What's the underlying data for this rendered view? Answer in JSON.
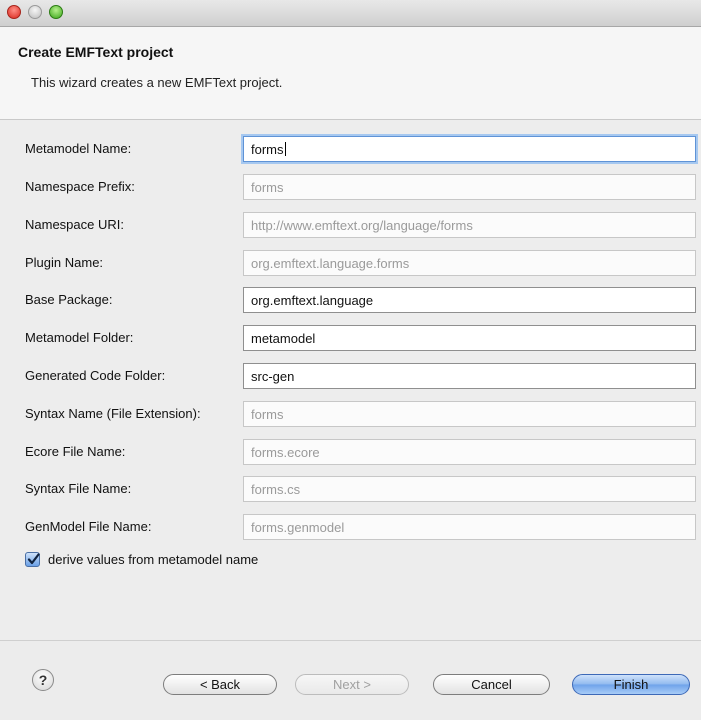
{
  "window": {
    "controls": {
      "close": "close",
      "minimize": "minimize",
      "zoom": "zoom"
    }
  },
  "header": {
    "title": "Create EMFText project",
    "description": "This wizard creates a new EMFText project."
  },
  "form": {
    "fields": [
      {
        "label": "Metamodel Name:",
        "value": "forms",
        "state": "enabled",
        "focused": true
      },
      {
        "label": "Namespace Prefix:",
        "value": "forms",
        "state": "disabled"
      },
      {
        "label": "Namespace URI:",
        "value": "http://www.emftext.org/language/forms",
        "state": "disabled"
      },
      {
        "label": "Plugin Name:",
        "value": "org.emftext.language.forms",
        "state": "disabled"
      },
      {
        "label": "Base Package:",
        "value": "org.emftext.language",
        "state": "enabled"
      },
      {
        "label": "Metamodel Folder:",
        "value": "metamodel",
        "state": "enabled"
      },
      {
        "label": "Generated Code Folder:",
        "value": "src-gen",
        "state": "enabled"
      },
      {
        "label": "Syntax Name (File Extension):",
        "value": "forms",
        "state": "disabled"
      },
      {
        "label": "Ecore File Name:",
        "value": "forms.ecore",
        "state": "disabled"
      },
      {
        "label": "Syntax File Name:",
        "value": "forms.cs",
        "state": "disabled"
      },
      {
        "label": "GenModel File Name:",
        "value": "forms.genmodel",
        "state": "disabled"
      }
    ],
    "derive_checkbox": {
      "label": "derive values from metamodel name",
      "checked": true
    }
  },
  "footer": {
    "help_icon": "question-mark-icon",
    "help_glyph": "?",
    "back_label": "< Back",
    "next_label": "Next >",
    "cancel_label": "Cancel",
    "finish_label": "Finish"
  },
  "colors": {
    "focus_ring": "#a6c8f0",
    "default_button": "#6ea2ea",
    "disabled_text": "#9a9a9a"
  }
}
